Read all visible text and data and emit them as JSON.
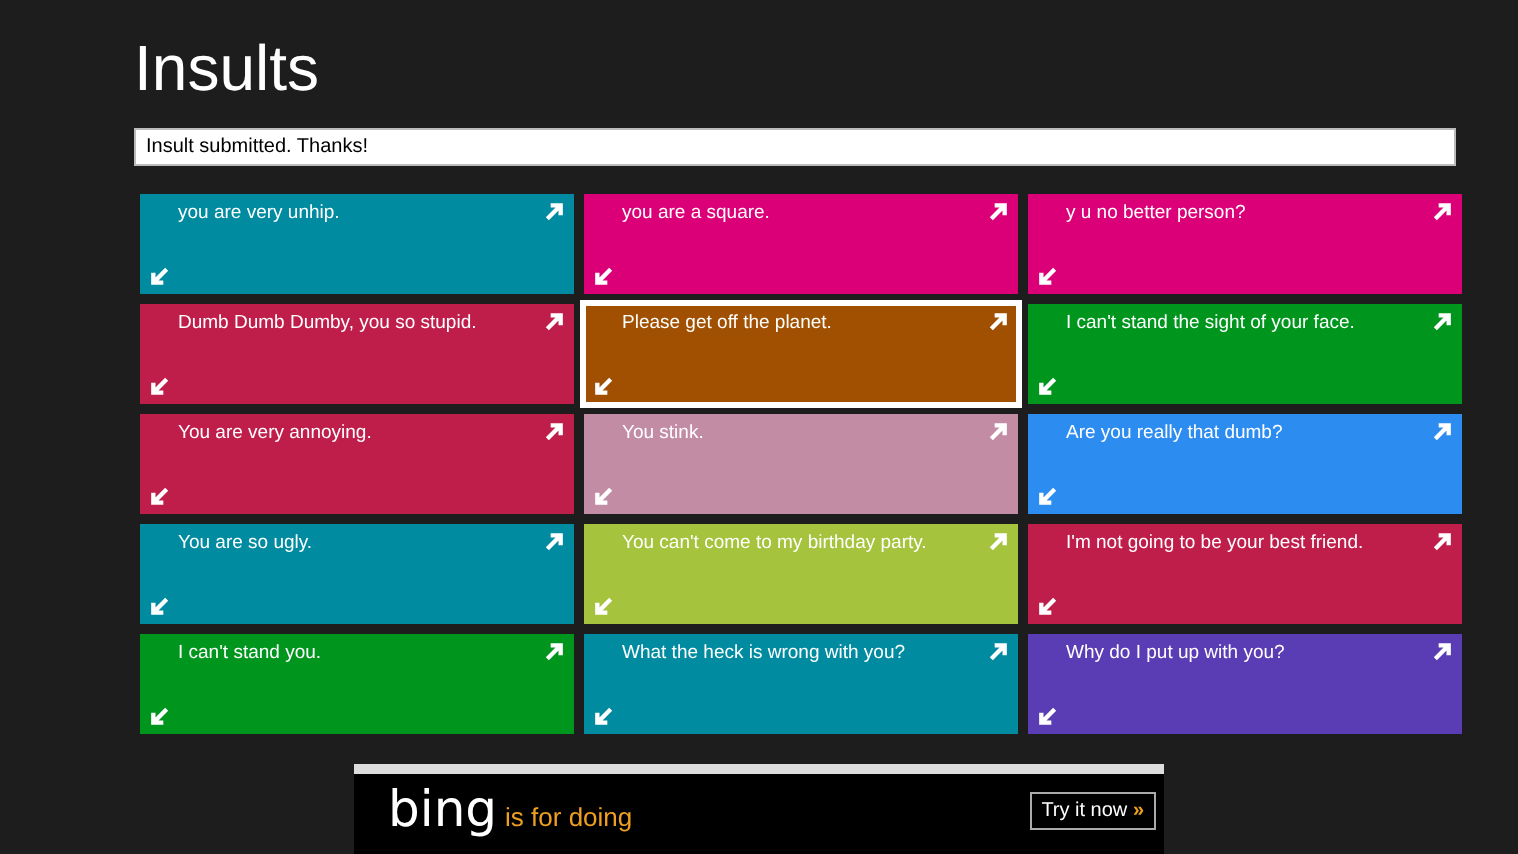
{
  "title": "Insults",
  "message_field": {
    "value": "Insult submitted. Thanks!"
  },
  "tiles": [
    {
      "text": "you are very unhip.",
      "color": "#008ba0",
      "selected": false
    },
    {
      "text": "you are a square.",
      "color": "#dc0078",
      "selected": false
    },
    {
      "text": "y u no better person?",
      "color": "#dc0078",
      "selected": false
    },
    {
      "text": "Dumb Dumb Dumby, you so stupid.",
      "color": "#bf1e4b",
      "selected": false
    },
    {
      "text": "Please get off the planet.",
      "color": "#a05000",
      "selected": true
    },
    {
      "text": "I can't stand the sight of your face.",
      "color": "#00961e",
      "selected": false
    },
    {
      "text": "You are very annoying.",
      "color": "#bf1e4b",
      "selected": false
    },
    {
      "text": "You stink.",
      "color": "#c38ca5",
      "selected": false
    },
    {
      "text": "Are you really that dumb?",
      "color": "#2d8cf0",
      "selected": false
    },
    {
      "text": "You are so ugly.",
      "color": "#008ba0",
      "selected": false
    },
    {
      "text": "You can't come to my birthday party.",
      "color": "#a5c33c",
      "selected": false
    },
    {
      "text": "I'm not going to be your best friend.",
      "color": "#bf1e4b",
      "selected": false
    },
    {
      "text": "I can't stand you.",
      "color": "#00961e",
      "selected": false
    },
    {
      "text": "What the heck is wrong with you?",
      "color": "#008ba0",
      "selected": false
    },
    {
      "text": "Why do I put up with you?",
      "color": "#5a3cb4",
      "selected": false
    }
  ],
  "ad": {
    "brand": "bing",
    "tagline": "is for doing",
    "button": "Try it now",
    "button_icon": "»"
  }
}
